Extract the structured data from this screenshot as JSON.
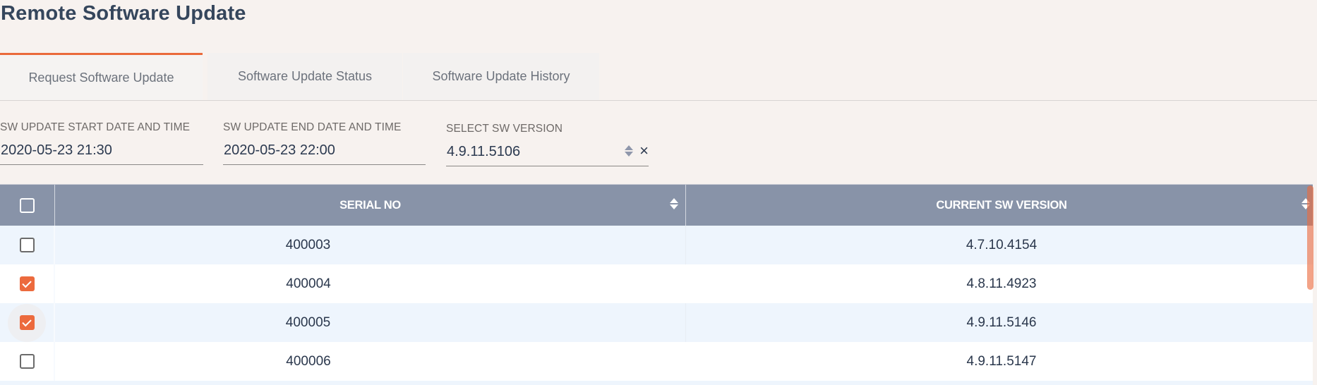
{
  "page": {
    "title": "Remote Software Update"
  },
  "tabs": [
    {
      "label": "Request Software Update",
      "active": true
    },
    {
      "label": "Software Update Status",
      "active": false
    },
    {
      "label": "Software Update History",
      "active": false
    }
  ],
  "form": {
    "start": {
      "label": "SW UPDATE START DATE AND TIME",
      "value": "2020-05-23 21:30"
    },
    "end": {
      "label": "SW UPDATE END DATE AND TIME",
      "value": "2020-05-23 22:00"
    },
    "version": {
      "label": "SELECT SW VERSION",
      "value": "4.9.11.5106",
      "clear_icon": "×"
    }
  },
  "table": {
    "columns": [
      {
        "key": "select",
        "label": ""
      },
      {
        "key": "serial",
        "label": "SERIAL NO"
      },
      {
        "key": "version",
        "label": "CURRENT SW VERSION"
      }
    ],
    "header_checked": false,
    "rows": [
      {
        "serial": "400003",
        "version": "4.7.10.4154",
        "checked": false
      },
      {
        "serial": "400004",
        "version": "4.8.11.4923",
        "checked": true
      },
      {
        "serial": "400005",
        "version": "4.9.11.5146",
        "checked": true
      },
      {
        "serial": "400006",
        "version": "4.9.11.5147",
        "checked": false
      }
    ]
  },
  "colors": {
    "accent": "#ec6a3d",
    "header_bg": "#8893a8",
    "row_alt": "#eef5fd",
    "page_bg": "#f7f2ef"
  }
}
